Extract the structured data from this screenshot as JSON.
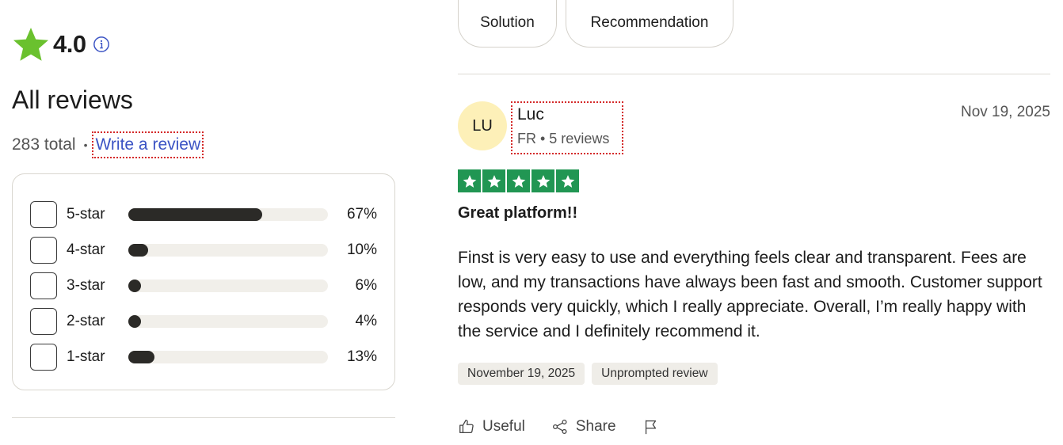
{
  "summary": {
    "rating": "4.0",
    "heading": "All reviews",
    "total_text": "283 total",
    "separator": "•",
    "write_review": "Write a review",
    "distribution": [
      {
        "label": "5-star",
        "percent_text": "67%",
        "percent": 67
      },
      {
        "label": "4-star",
        "percent_text": "10%",
        "percent": 10
      },
      {
        "label": "3-star",
        "percent_text": "6%",
        "percent": 6
      },
      {
        "label": "2-star",
        "percent_text": "4%",
        "percent": 4
      },
      {
        "label": "1-star",
        "percent_text": "13%",
        "percent": 13
      }
    ],
    "colors": {
      "star": "#6ac12e",
      "bar_fill": "#2b2a27",
      "bar_track": "#f1efea"
    }
  },
  "filters": {
    "chips": [
      "Solution",
      "Recommendation"
    ]
  },
  "review": {
    "avatar_initials": "LU",
    "avatar_color": "#fdf0b8",
    "name": "Luc",
    "meta": "FR • 5 reviews",
    "date": "Nov 19, 2025",
    "stars": 5,
    "star_color": "#219653",
    "title": "Great platform!!",
    "body": "Finst is very easy to use and everything feels clear and transparent. Fees are low, and my transactions have always been fast and smooth. Customer support responds very quickly, which I really appreciate. Overall, I’m really happy with the service and I definitely recommend it.",
    "tags": [
      "November 19, 2025",
      "Unprompted review"
    ],
    "actions": {
      "useful": "Useful",
      "share": "Share"
    },
    "icons": [
      "info-icon",
      "star-icon",
      "thumbs-up-icon",
      "share-icon",
      "flag-icon"
    ]
  }
}
